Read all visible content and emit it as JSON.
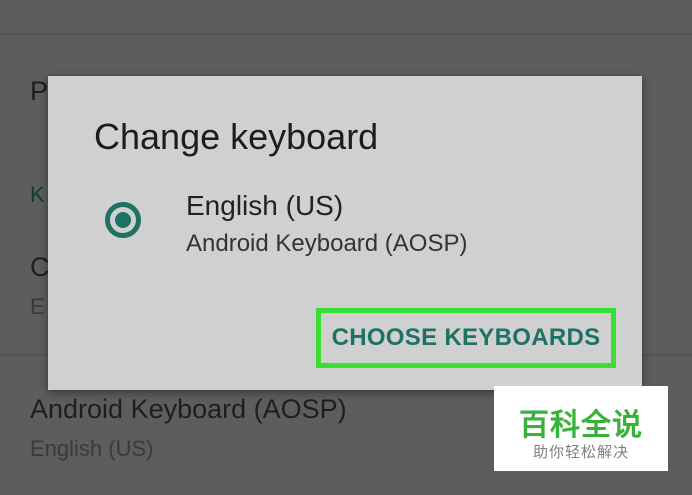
{
  "background": {
    "peek_letters": [
      "P",
      "K",
      "C",
      "E"
    ],
    "keyboard_item": {
      "title": "Android Keyboard (AOSP)",
      "subtitle": "English (US)"
    }
  },
  "dialog": {
    "title": "Change keyboard",
    "options": [
      {
        "title": "English (US)",
        "subtitle": "Android Keyboard (AOSP)",
        "selected": true
      }
    ],
    "action_label": "CHOOSE KEYBOARDS"
  },
  "watermark": {
    "main": "百科全说",
    "sub": "助你轻松解决"
  },
  "colors": {
    "accent": "#1e7264",
    "highlight_box": "#39e034",
    "watermark_green": "#38b33a"
  }
}
